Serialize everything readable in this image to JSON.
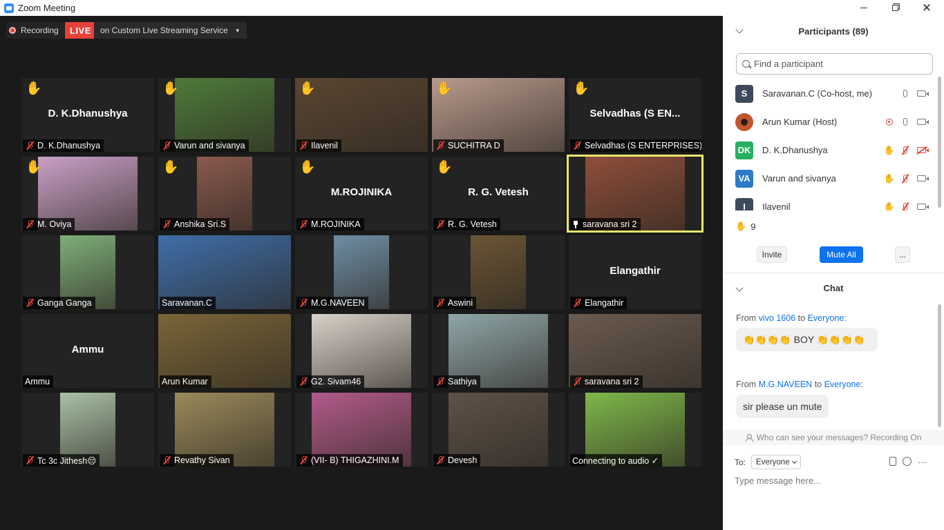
{
  "window": {
    "title": "Zoom Meeting",
    "controls": [
      "minimize",
      "restore",
      "close"
    ]
  },
  "recording": {
    "label": "Recording"
  },
  "live": {
    "badge": "LIVE",
    "service": "on Custom Live Streaming Service"
  },
  "tiles": [
    {
      "name": "D. K.Dhanushya",
      "big_name": "D. K.Dhanushya",
      "hand": true,
      "muted": true,
      "video": false
    },
    {
      "name": "Varun and sivanya",
      "hand": true,
      "muted": true,
      "video": true,
      "bg": "#4e7a3a"
    },
    {
      "name": "Ilavenil",
      "hand": true,
      "muted": true,
      "video": true,
      "bg": "#5a4632"
    },
    {
      "name": "SUCHITRA D",
      "hand": true,
      "muted": true,
      "video": true,
      "bg": "#b89a8c"
    },
    {
      "name": "Selvadhas (S ENTERPRISES)",
      "big_name": "Selvadhas  (S EN...",
      "hand": true,
      "muted": true,
      "video": false
    },
    {
      "name": "M. Oviya",
      "hand": true,
      "muted": true,
      "video": true,
      "bg": "#c9a0c6"
    },
    {
      "name": "Anshika Sri.S",
      "hand": true,
      "muted": true,
      "video": true,
      "bg": "#8a5a4e"
    },
    {
      "name": "M.ROJINIKA",
      "big_name": "M.ROJINIKA",
      "hand": true,
      "muted": true,
      "video": false
    },
    {
      "name": "R. G. Vetesh",
      "big_name": "R. G. Vetesh",
      "hand": true,
      "muted": true,
      "video": false
    },
    {
      "name": "saravana sri 2",
      "hand": false,
      "muted": false,
      "pinned": true,
      "video": true,
      "active": true,
      "bg": "#8f4e3a"
    },
    {
      "name": "Ganga Ganga",
      "hand": false,
      "muted": true,
      "video": true,
      "bg": "#7fae7a"
    },
    {
      "name": "Saravanan.C",
      "hand": false,
      "muted": false,
      "video": true,
      "bg": "#3f6ea8"
    },
    {
      "name": "M.G.NAVEEN",
      "hand": false,
      "muted": true,
      "video": true,
      "bg": "#6f8ea4"
    },
    {
      "name": "Aswini",
      "hand": false,
      "muted": true,
      "video": true,
      "bg": "#6b5535"
    },
    {
      "name": "Elangathir",
      "big_name": "Elangathir",
      "hand": false,
      "muted": true,
      "video": false
    },
    {
      "name": "Ammu",
      "big_name": "Ammu",
      "hand": false,
      "muted": false,
      "video": false
    },
    {
      "name": "Arun Kumar",
      "hand": false,
      "muted": false,
      "video": true,
      "bg": "#7a6538"
    },
    {
      "name": "G2. Sivam46",
      "hand": false,
      "muted": true,
      "video": true,
      "bg": "#d9d2c9"
    },
    {
      "name": "Sathiya",
      "hand": false,
      "muted": true,
      "video": true,
      "bg": "#8fa6a8"
    },
    {
      "name": "saravana sri 2",
      "hand": false,
      "muted": true,
      "video": true,
      "bg": "#6b5b4f"
    },
    {
      "name": "Tc 3c Jithesh😔",
      "hand": false,
      "muted": true,
      "video": true,
      "bg": "#a9c1a6"
    },
    {
      "name": "Revathy Sivan",
      "hand": false,
      "muted": true,
      "video": true,
      "bg": "#9a8a5a"
    },
    {
      "name": "(VII- B) THIGAZHINI.M",
      "hand": false,
      "muted": true,
      "video": true,
      "bg": "#b25a8a"
    },
    {
      "name": "Devesh",
      "hand": false,
      "muted": true,
      "video": true,
      "bg": "#5e5248"
    },
    {
      "name": "Connecting to audio ✓",
      "hand": false,
      "muted": false,
      "video": true,
      "bg": "#7fb84a"
    }
  ],
  "participants": {
    "header": "Participants (89)",
    "search_placeholder": "Find a participant",
    "list": [
      {
        "initials": "S",
        "name": "Saravanan.C (Co-host, me)",
        "avatar_color": "#3d4a5c"
      },
      {
        "initials": "",
        "name": "Arun Kumar (Host)",
        "avatar_color": "#c0562f"
      },
      {
        "initials": "DK",
        "name": "D. K.Dhanushya",
        "avatar_color": "#27ae60"
      },
      {
        "initials": "VA",
        "name": "Varun and sivanya",
        "avatar_color": "#2c7ac9"
      },
      {
        "initials": "I",
        "name": "Ilavenil",
        "avatar_color": "#3d4a5c"
      }
    ],
    "raised_hands": "9",
    "invite_label": "Invite",
    "mute_all_label": "Mute All",
    "more_label": "..."
  },
  "chat": {
    "header": "Chat",
    "messages": [
      {
        "from_label": "From",
        "sender": "vivo 1606",
        "to_label": "to",
        "recipient": "Everyone:",
        "text": "👏👏👏👏  BOY  👏👏👏👏"
      },
      {
        "from_label": "From",
        "sender": "M.G.NAVEEN",
        "to_label": "to",
        "recipient": "Everyone:",
        "text": "sir please un  mute"
      }
    ],
    "privacy_note": "Who can see your messages? Recording On",
    "to_label": "To:",
    "to_value": "Everyone",
    "input_placeholder": "Type message here...",
    "more_label": "···"
  }
}
